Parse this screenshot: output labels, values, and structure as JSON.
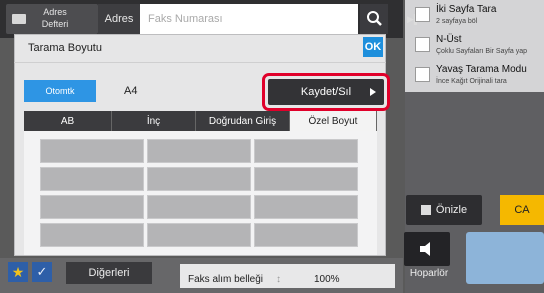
{
  "header": {
    "address_book_label": "Adres Defteri",
    "address_tab_label": "Adres",
    "fax_input_placeholder": "Faks Numarası"
  },
  "dialog": {
    "title": "Tarama Boyutu",
    "ok_label": "OK",
    "auto_label": "Otomtk",
    "selected_size": "A4",
    "save_delete_label": "Kaydet/Sıl",
    "tabs": [
      {
        "label": "AB",
        "active": false
      },
      {
        "label": "İnç",
        "active": false
      },
      {
        "label": "Doğrudan Giriş",
        "active": false
      },
      {
        "label": "Özel Boyut",
        "active": true
      }
    ]
  },
  "right_panel": {
    "items": [
      {
        "title": "İki Sayfa Tara",
        "subtitle": "2 sayfaya böl"
      },
      {
        "title": "N-Üst",
        "subtitle": "Çoklu Sayfaları Bir Sayfa yap"
      },
      {
        "title": "Yavaş Tarama Modu",
        "subtitle": "İnce Kağıt Orijinali tara"
      }
    ],
    "preview_label": "Önizle",
    "ca_label": "CA",
    "speaker_label": "Hoparlör"
  },
  "bottom": {
    "others_label": "Diğerleri",
    "memory_label": "Faks alım belleği",
    "memory_value": "100%"
  },
  "colors": {
    "accent_blue": "#2e95e4",
    "highlight_red": "#e0002a",
    "ca_yellow": "#f5b800"
  }
}
